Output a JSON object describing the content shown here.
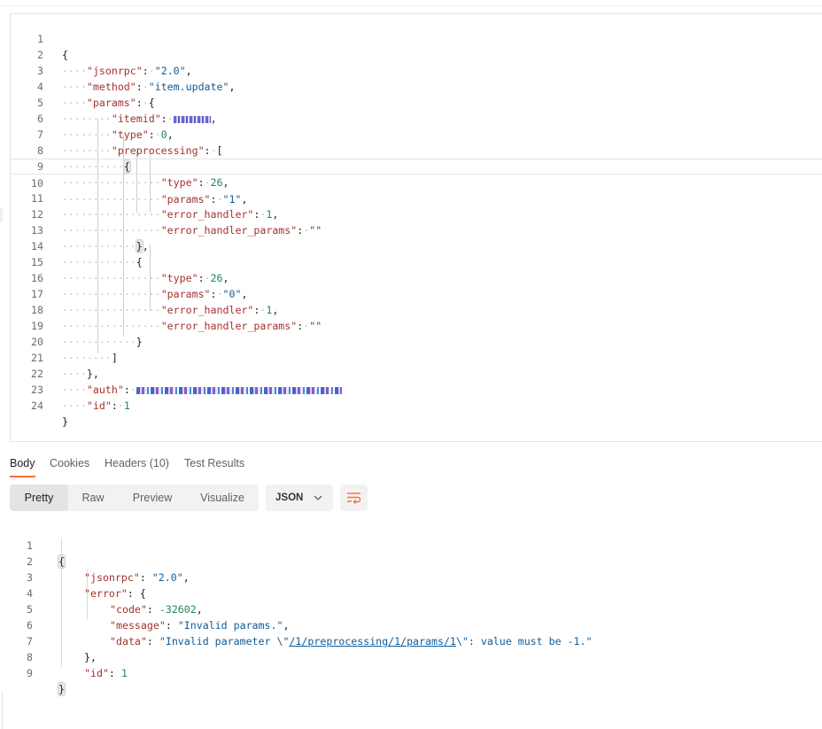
{
  "request": {
    "lines": [
      {
        "n": "1"
      },
      {
        "n": "2"
      },
      {
        "n": "3"
      },
      {
        "n": "4"
      },
      {
        "n": "5"
      },
      {
        "n": "6"
      },
      {
        "n": "7"
      },
      {
        "n": "8"
      },
      {
        "n": "9"
      },
      {
        "n": "10"
      },
      {
        "n": "11"
      },
      {
        "n": "12"
      },
      {
        "n": "13"
      },
      {
        "n": "14"
      },
      {
        "n": "15"
      },
      {
        "n": "16"
      },
      {
        "n": "17"
      },
      {
        "n": "18"
      },
      {
        "n": "19"
      },
      {
        "n": "20"
      },
      {
        "n": "21"
      },
      {
        "n": "22"
      },
      {
        "n": "23"
      },
      {
        "n": "24"
      }
    ],
    "keys": {
      "jsonrpc": "\"jsonrpc\"",
      "method": "\"method\"",
      "params": "\"params\"",
      "itemid": "\"itemid\"",
      "type": "\"type\"",
      "preprocessing": "\"preprocessing\"",
      "error_handler": "\"error_handler\"",
      "error_handler_params": "\"error_handler_params\"",
      "auth": "\"auth\"",
      "id": "\"id\""
    },
    "values": {
      "jsonrpc": "\"2.0\"",
      "method": "\"item.update\"",
      "type_zero": "0",
      "step1_type": "26",
      "step1_params": "\"1\"",
      "step1_error_handler": "1",
      "step1_error_handler_params": "\"\"",
      "step2_type": "26",
      "step2_params": "\"0\"",
      "step2_error_handler": "1",
      "step2_error_handler_params": "\"\"",
      "id": "1"
    }
  },
  "response_tabs": [
    {
      "label": "Body"
    },
    {
      "label": "Cookies"
    },
    {
      "label": "Headers (10)"
    },
    {
      "label": "Test Results"
    }
  ],
  "view_modes": [
    {
      "label": "Pretty"
    },
    {
      "label": "Raw"
    },
    {
      "label": "Preview"
    },
    {
      "label": "Visualize"
    }
  ],
  "format_select": {
    "value": "JSON"
  },
  "icons": {
    "wrap": "text-wrap-icon",
    "chevron": "chevron-down-icon"
  },
  "colors": {
    "accent": "#ff6c37",
    "key": "#a4332b",
    "string": "#0f5c99",
    "number": "#1e8a55"
  },
  "response": {
    "lines": [
      {
        "n": "1"
      },
      {
        "n": "2"
      },
      {
        "n": "3"
      },
      {
        "n": "4"
      },
      {
        "n": "5"
      },
      {
        "n": "6"
      },
      {
        "n": "7"
      },
      {
        "n": "8"
      },
      {
        "n": "9"
      }
    ],
    "keys": {
      "jsonrpc": "\"jsonrpc\"",
      "error": "\"error\"",
      "code": "\"code\"",
      "message": "\"message\"",
      "data": "\"data\"",
      "id": "\"id\""
    },
    "values": {
      "jsonrpc": "\"2.0\"",
      "code": "-32602",
      "message": "\"Invalid params.\"",
      "data_prefix": "\"Invalid parameter \\\"",
      "data_link": "/1/preprocessing/1/params/1",
      "data_suffix": "\\\": value must be -1.\"",
      "id": "1"
    }
  }
}
